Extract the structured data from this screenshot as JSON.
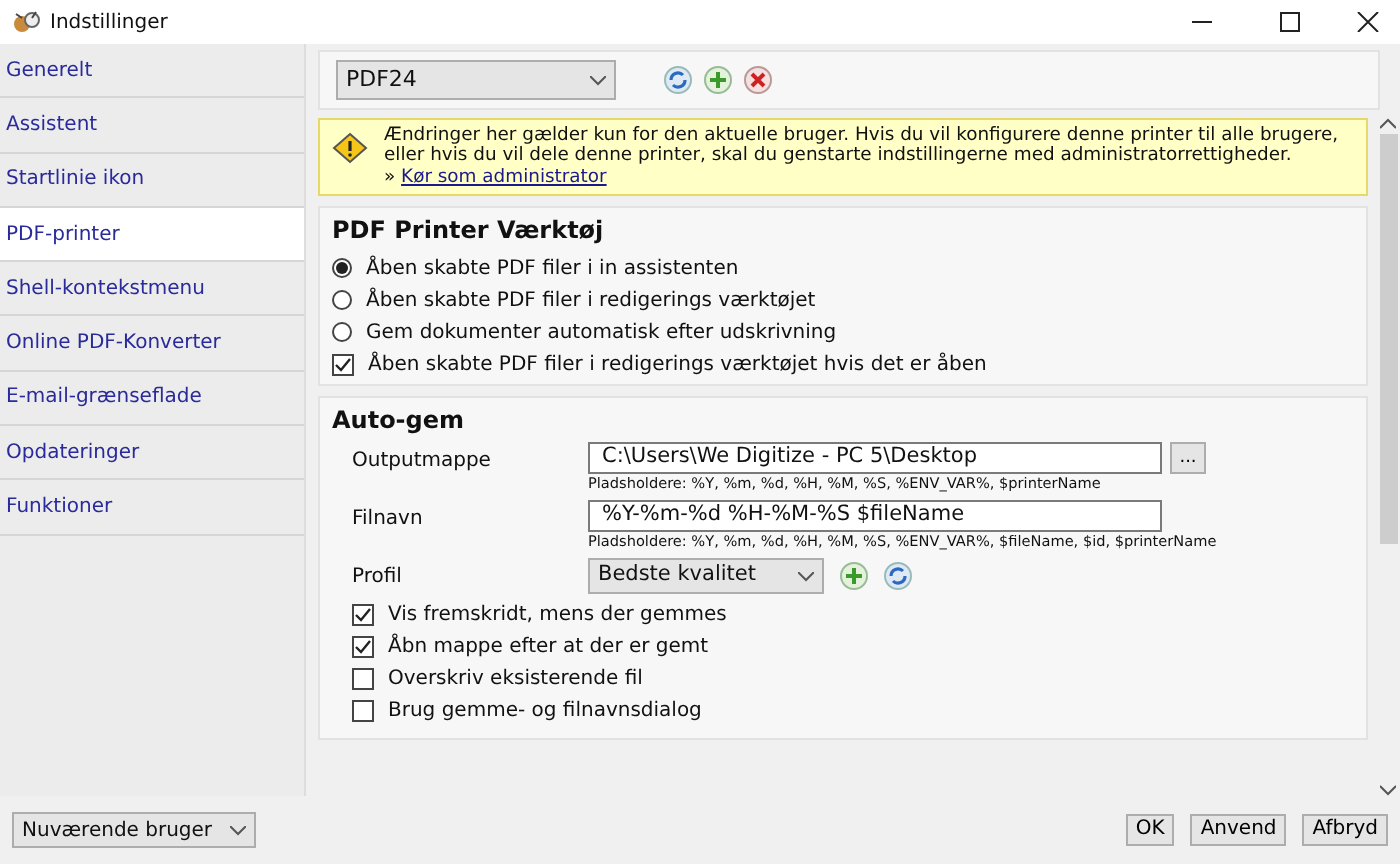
{
  "window": {
    "title": "Indstillinger"
  },
  "sidebar": {
    "items": [
      {
        "label": "Generelt",
        "selected": false
      },
      {
        "label": "Assistent",
        "selected": false
      },
      {
        "label": "Startlinie ikon",
        "selected": false
      },
      {
        "label": "PDF-printer",
        "selected": true
      },
      {
        "label": "Shell-kontekstmenu",
        "selected": false
      },
      {
        "label": "Online PDF-Konverter",
        "selected": false
      },
      {
        "label": "E-mail-grænseflade",
        "selected": false
      },
      {
        "label": "Opdateringer",
        "selected": false
      },
      {
        "label": "Funktioner",
        "selected": false
      }
    ]
  },
  "printer_select": {
    "value": "PDF24"
  },
  "notice": {
    "text": "Ændringer her gælder kun for den aktuelle bruger. Hvis du vil konfigurere denne printer til alle brugere, eller hvis du vil dele denne printer, skal du genstarte indstillingerne med administratorrettigheder.",
    "link_prefix": "»",
    "link": "Kør som administrator"
  },
  "tool_section": {
    "title": "PDF Printer Værktøj",
    "options": [
      {
        "kind": "radio",
        "label": "Åben skabte PDF filer i in assistenten",
        "checked": true
      },
      {
        "kind": "radio",
        "label": "Åben skabte PDF filer i redigerings værktøjet",
        "checked": false
      },
      {
        "kind": "radio",
        "label": "Gem dokumenter automatisk efter udskrivning",
        "checked": false
      },
      {
        "kind": "checkbox",
        "label": "Åben skabte PDF filer i redigerings værktøjet hvis det er åben",
        "checked": true
      }
    ]
  },
  "autosave_section": {
    "title": "Auto-gem",
    "fields": [
      {
        "kind": "path",
        "label": "Outputmappe",
        "value": "C:\\Users\\We Digitize - PC 5\\Desktop",
        "browse": "...",
        "hint": "Pladsholdere: %Y, %m, %d, %H, %M, %S, %ENV_VAR%, $printerName"
      },
      {
        "kind": "text",
        "label": "Filnavn",
        "value": "%Y-%m-%d %H-%M-%S $fileName",
        "hint": "Pladsholdere: %Y, %m, %d, %H, %M, %S, %ENV_VAR%, $fileName, $id, $printerName"
      },
      {
        "kind": "select",
        "label": "Profil",
        "value": "Bedste kvalitet"
      }
    ],
    "options": [
      {
        "label": "Vis fremskridt, mens der gemmes",
        "checked": true
      },
      {
        "label": "Åbn mappe efter at der er gemt",
        "checked": true
      },
      {
        "label": "Overskriv eksisterende fil",
        "checked": false
      },
      {
        "label": "Brug gemme- og filnavnsdialog",
        "checked": false
      }
    ]
  },
  "footer": {
    "scope_select": "Nuværende bruger",
    "buttons": [
      "OK",
      "Anvend",
      "Afbryd"
    ]
  }
}
